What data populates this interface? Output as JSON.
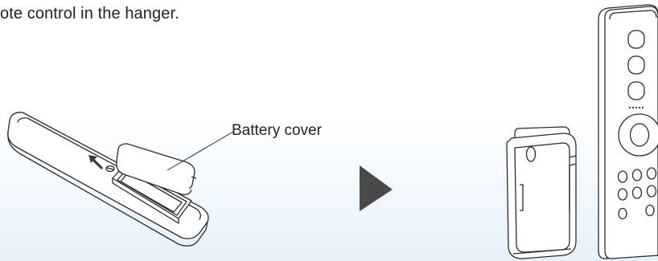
{
  "text": {
    "instruction": "ote control in the hanger.",
    "battery_cover_label": "Battery cover"
  },
  "colors": {
    "line": "#2b2b2b",
    "arrow_fill": "#4a4a4a",
    "text": "#222222",
    "background_tint": "#e6f1fa"
  },
  "icons": {
    "next_step": "play-triangle-icon",
    "slide_direction": "arrow-up-left-icon"
  }
}
